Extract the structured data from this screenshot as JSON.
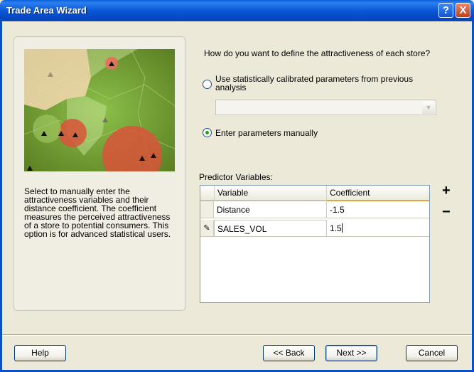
{
  "window": {
    "title": "Trade Area Wizard",
    "help_glyph": "?",
    "close_glyph": "X"
  },
  "left_panel": {
    "description": "Select to manually enter the attractiveness variables and their distance coefficient. The coefficient measures the perceived attractiveness of a store to potential consumers. This option is for advanced statistical users."
  },
  "main": {
    "question": "How do you want to define the attractiveness of each store?",
    "option_calibrated": "Use statistically calibrated parameters from previous analysis",
    "calibrated_select_value": "",
    "option_manual": "Enter parameters manually",
    "selected_option": "manual",
    "predictor_label": "Predictor Variables:",
    "grid": {
      "columns": [
        "Variable",
        "Coefficient"
      ],
      "rows": [
        {
          "variable": "Distance",
          "coefficient": "-1.5"
        },
        {
          "variable": "SALES_VOL",
          "coefficient": "1.5",
          "editing": true,
          "indicator": "✎"
        }
      ]
    },
    "add_symbol": "+",
    "remove_symbol": "−"
  },
  "buttons": {
    "help": "Help",
    "back": "<< Back",
    "next": "Next >>",
    "cancel": "Cancel"
  },
  "icons": [
    "help-icon",
    "close-icon",
    "dropdown-arrow-icon",
    "edit-pencil-icon",
    "add-icon",
    "remove-icon"
  ],
  "colors": {
    "titlebar": "#0b58d6",
    "dialog_bg": "#ece9d8",
    "radio_dot": "#21a121",
    "map_green": "#7aa43a",
    "zone_red": "#d9543a",
    "zone_peach": "#f5d9b0"
  }
}
